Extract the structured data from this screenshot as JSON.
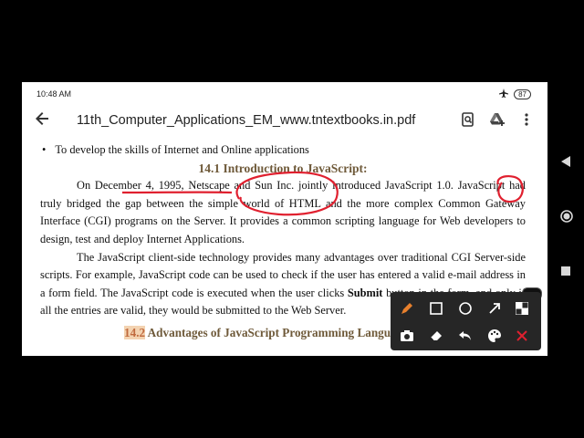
{
  "status_bar": {
    "time": "10:48 AM",
    "battery": "87"
  },
  "app_bar": {
    "title": "11th_Computer_Applications_EM_www.tntextbooks.in.pdf"
  },
  "document": {
    "bullet": "To develop the skills of Internet and Online applications",
    "heading": "14.1 Introduction to JavaScript:",
    "para1": "On December 4, 1995, Netscape and Sun Inc. jointly introduced JavaScript 1.0. JavaScript had truly bridged the gap between the simple world of HTML and the more complex Common Gateway Interface (CGI) programs on the Server. It provides a common scripting language for Web developers to design, test and deploy Internet Applications.",
    "para2_before": "The JavaScript client-side technology provides many advantages over traditional CGI Server-side scripts. For example, JavaScript code can be used to check if the user has entered a valid e-mail address in a form field. The JavaScript code is executed when the user clicks",
    "para2_bold": "Submit",
    "para2_after": "button in the form, and only if all the entries are valid, they would be submitted to the Web Server.",
    "heading2_num": "14.2",
    "heading2_text": "Advantages of JavaScript Programming Language"
  },
  "colors": {
    "annotation_red": "#e0202f",
    "heading_brown": "#6f5a3a",
    "toolbar_bg": "#262626"
  },
  "icons": {
    "status": [
      "airplane-icon",
      "battery-icon"
    ],
    "app_bar": [
      "back-arrow-icon",
      "search-doc-icon",
      "drive-add-icon",
      "more-vert-icon"
    ],
    "nav": [
      "back-triangle-icon",
      "home-circle-icon",
      "recents-square-icon"
    ],
    "toolbar": [
      "pen-icon",
      "rectangle-icon",
      "circle-icon",
      "arrow-icon",
      "mosaic-icon",
      "camera-icon",
      "eraser-icon",
      "undo-icon",
      "palette-icon",
      "close-icon"
    ]
  }
}
